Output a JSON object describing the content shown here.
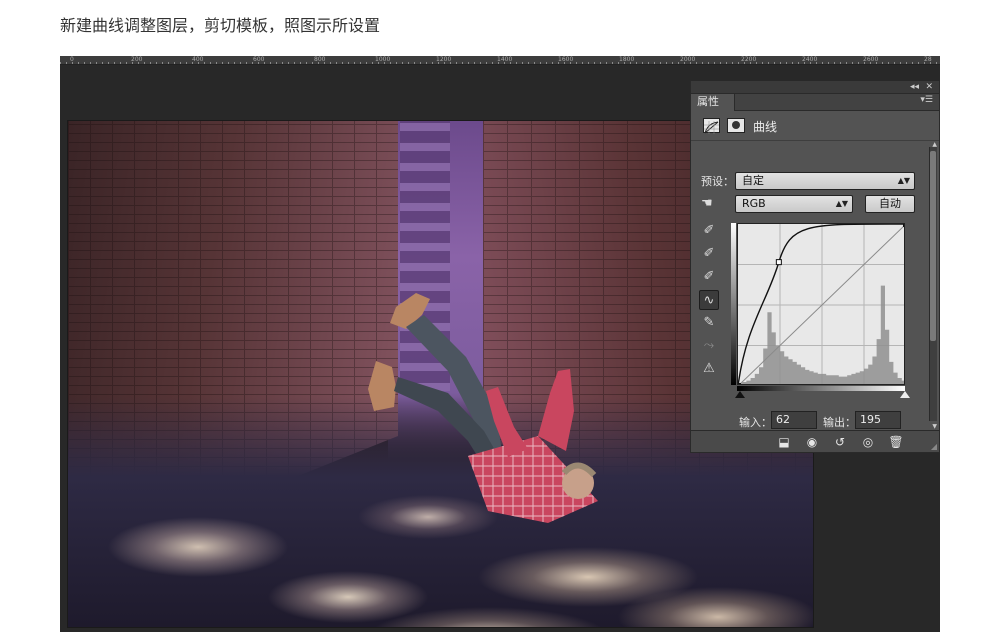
{
  "caption": "新建曲线调整图层，剪切模板，照图示所设置",
  "ruler": {
    "ticks": [
      "0",
      "200",
      "400",
      "600",
      "800",
      "1000",
      "1200",
      "1400",
      "1600",
      "1800",
      "2000",
      "2200",
      "2400",
      "2600",
      "28"
    ]
  },
  "panel": {
    "tab_label": "属性",
    "collapse_icon": "◂◂",
    "close_icon": "✕",
    "menu_icon": "▾☰",
    "adjustment_title": "曲线",
    "preset": {
      "label": "预设：",
      "value": "自定"
    },
    "channel": {
      "value": "RGB"
    },
    "auto_button": "自动",
    "input": {
      "label": "输入：",
      "value": "62"
    },
    "output": {
      "label": "输出：",
      "value": "195"
    },
    "tools": [
      {
        "name": "eyedropper-black-icon",
        "glyph": "✐"
      },
      {
        "name": "eyedropper-gray-icon",
        "glyph": "✐"
      },
      {
        "name": "eyedropper-white-icon",
        "glyph": "✐"
      },
      {
        "name": "curve-point-tool-icon",
        "glyph": "∿"
      },
      {
        "name": "pencil-tool-icon",
        "glyph": "✎"
      },
      {
        "name": "smooth-curve-icon",
        "glyph": "⤳"
      },
      {
        "name": "clipping-warning-icon",
        "glyph": "⚠"
      }
    ],
    "bottom_icons": [
      {
        "name": "clip-to-layer-icon",
        "glyph": "⬓"
      },
      {
        "name": "view-previous-state-icon",
        "glyph": "◉"
      },
      {
        "name": "reset-icon",
        "glyph": "↺"
      },
      {
        "name": "toggle-visibility-icon",
        "glyph": "◎"
      },
      {
        "name": "delete-icon",
        "glyph": "🗑"
      }
    ]
  },
  "curve": {
    "points": [
      [
        0,
        0
      ],
      [
        62,
        195
      ],
      [
        255,
        255
      ]
    ],
    "histogram": [
      2,
      3,
      4,
      6,
      9,
      14,
      28,
      55,
      40,
      30,
      26,
      22,
      20,
      18,
      16,
      14,
      12,
      11,
      10,
      9,
      9,
      8,
      8,
      8,
      7,
      7,
      8,
      9,
      10,
      11,
      13,
      16,
      22,
      35,
      75,
      42,
      18,
      10,
      6,
      4
    ]
  }
}
